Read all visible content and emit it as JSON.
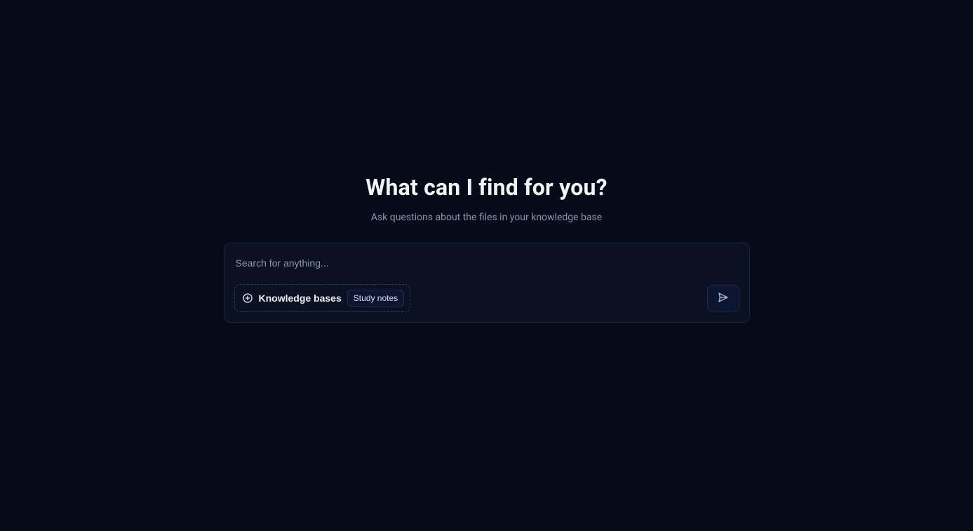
{
  "hero": {
    "title": "What can I find for you?",
    "subtitle": "Ask questions about the files in your knowledge base"
  },
  "search": {
    "placeholder": "Search for anything...",
    "value": ""
  },
  "knowledge": {
    "label": "Knowledge bases",
    "selected": "Study notes"
  }
}
